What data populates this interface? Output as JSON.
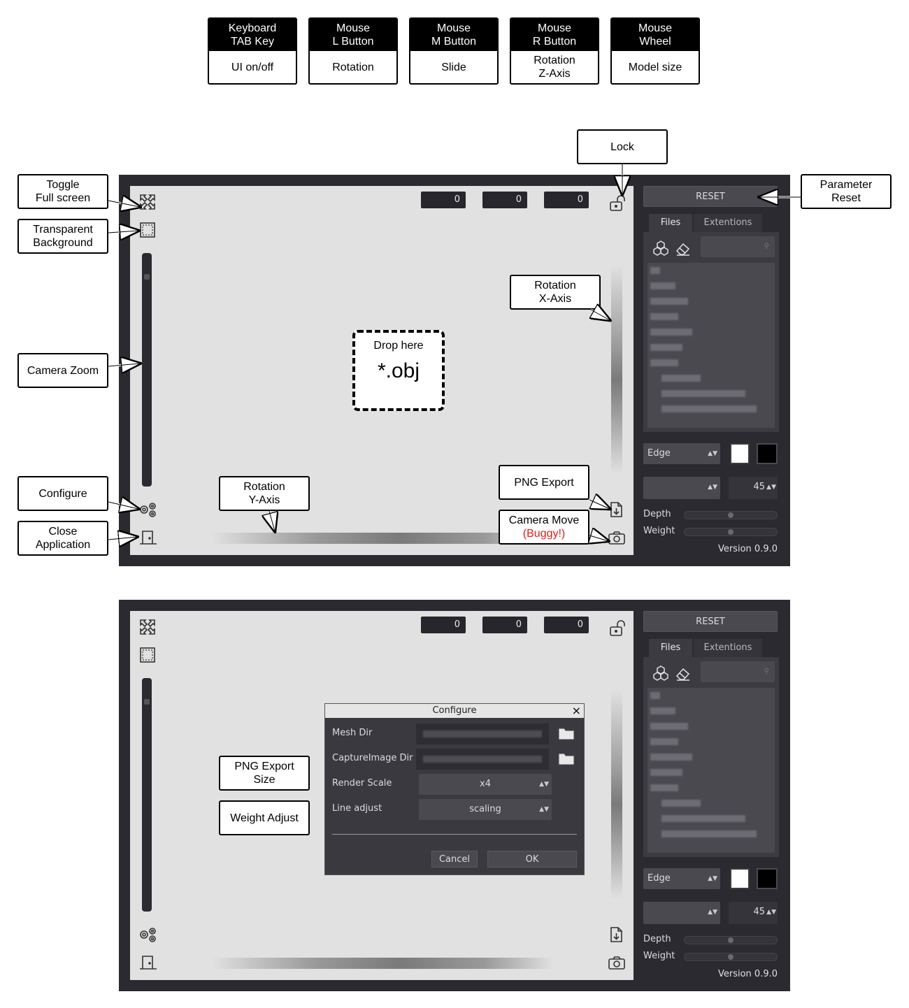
{
  "keys": [
    {
      "top1": "Keyboard",
      "top2": "TAB Key",
      "bot1": "UI on/off",
      "bot2": ""
    },
    {
      "top1": "Mouse",
      "top2": "L Button",
      "bot1": "Rotation",
      "bot2": ""
    },
    {
      "top1": "Mouse",
      "top2": "M Button",
      "bot1": "Slide",
      "bot2": ""
    },
    {
      "top1": "Mouse",
      "top2": "R Button",
      "bot1": "Rotation",
      "bot2": "Z-Axis"
    },
    {
      "top1": "Mouse",
      "top2": "Wheel",
      "bot1": "Model size",
      "bot2": ""
    }
  ],
  "callouts": {
    "lock": "Lock",
    "toggle_full_1": "Toggle",
    "toggle_full_2": "Full screen",
    "transparent_1": "Transparent",
    "transparent_2": "Background",
    "camera_zoom": "Camera Zoom",
    "configure": "Configure",
    "close_1": "Close",
    "close_2": "Application",
    "param_reset_1": "Parameter",
    "param_reset_2": "Reset",
    "rot_x_1": "Rotation",
    "rot_x_2": "X-Axis",
    "rot_y_1": "Rotation",
    "rot_y_2": "Y-Axis",
    "png_export": "PNG Export",
    "camera_move_1": "Camera Move",
    "camera_move_2": "(Buggy!)",
    "png_export_size_1": "PNG Export",
    "png_export_size_2": "Size",
    "weight_adjust": "Weight Adjust"
  },
  "drop": {
    "line1": "Drop here",
    "line2": "*.obj"
  },
  "app": {
    "coords": [
      "0",
      "0",
      "0"
    ],
    "reset_label": "RESET",
    "tabs": [
      "Files",
      "Extentions"
    ],
    "edge_select": "Edge",
    "angle_value": "45",
    "depth_label": "Depth",
    "weight_label": "Weight",
    "version": "Version 0.9.0",
    "depth_level": 0.5,
    "weight_level": 0.5
  },
  "dialog": {
    "title": "Configure",
    "close": "×",
    "mesh_dir_label": "Mesh Dir",
    "capture_dir_label": "CaptureImage Dir",
    "render_scale_label": "Render Scale",
    "render_scale_value": "x4",
    "line_adjust_label": "Line adjust",
    "line_adjust_value": "scaling",
    "cancel": "Cancel",
    "ok": "OK"
  },
  "colors": {
    "frame": "#2b2a30",
    "viewport": "#e1e1e1",
    "accent_red": "#e0201b"
  }
}
